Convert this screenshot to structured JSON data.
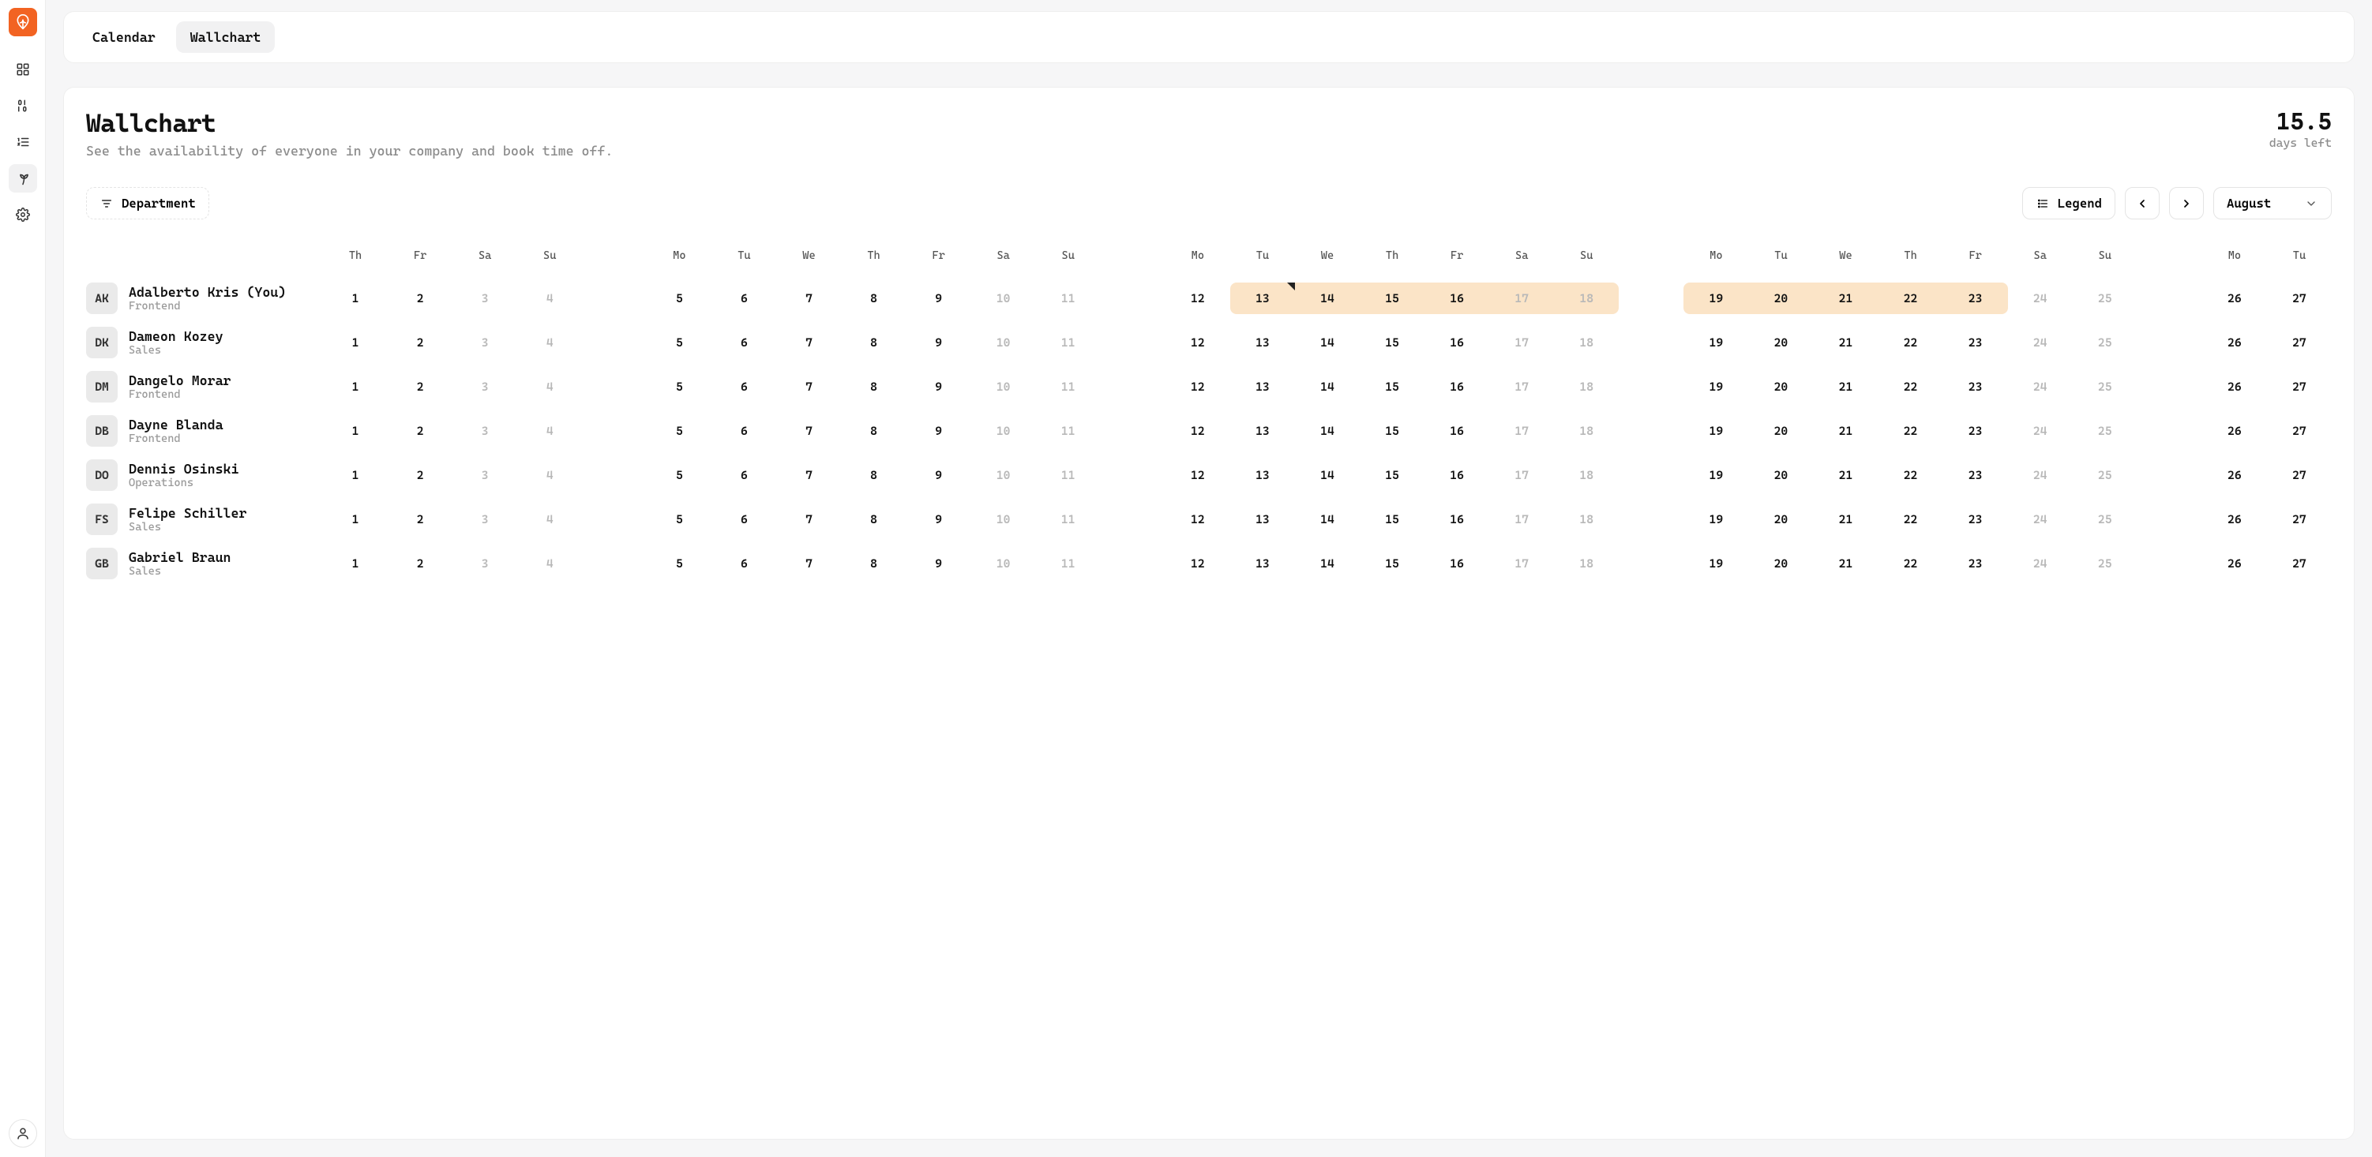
{
  "sidebar": {
    "items": [
      "dashboard",
      "binary",
      "tasks",
      "timeoff",
      "settings"
    ]
  },
  "tabs": [
    {
      "id": "calendar",
      "label": "Calendar",
      "active": false
    },
    {
      "id": "wallchart",
      "label": "Wallchart",
      "active": true
    }
  ],
  "header": {
    "title": "Wallchart",
    "subtitle": "See the availability of everyone in your company and book time off.",
    "days_left_value": "15.5",
    "days_left_label": "days left"
  },
  "controls": {
    "filter_label": "Department",
    "legend_label": "Legend",
    "month_label": "August"
  },
  "calendar": {
    "columns": [
      {
        "type": "day",
        "dow": "Th",
        "num": 1,
        "weekend": false
      },
      {
        "type": "day",
        "dow": "Fr",
        "num": 2,
        "weekend": false
      },
      {
        "type": "day",
        "dow": "Sa",
        "num": 3,
        "weekend": true
      },
      {
        "type": "day",
        "dow": "Su",
        "num": 4,
        "weekend": true
      },
      {
        "type": "spacer"
      },
      {
        "type": "day",
        "dow": "Mo",
        "num": 5,
        "weekend": false
      },
      {
        "type": "day",
        "dow": "Tu",
        "num": 6,
        "weekend": false
      },
      {
        "type": "day",
        "dow": "We",
        "num": 7,
        "weekend": false
      },
      {
        "type": "day",
        "dow": "Th",
        "num": 8,
        "weekend": false
      },
      {
        "type": "day",
        "dow": "Fr",
        "num": 9,
        "weekend": false
      },
      {
        "type": "day",
        "dow": "Sa",
        "num": 10,
        "weekend": true
      },
      {
        "type": "day",
        "dow": "Su",
        "num": 11,
        "weekend": true
      },
      {
        "type": "spacer"
      },
      {
        "type": "day",
        "dow": "Mo",
        "num": 12,
        "weekend": false
      },
      {
        "type": "day",
        "dow": "Tu",
        "num": 13,
        "weekend": false
      },
      {
        "type": "day",
        "dow": "We",
        "num": 14,
        "weekend": false
      },
      {
        "type": "day",
        "dow": "Th",
        "num": 15,
        "weekend": false
      },
      {
        "type": "day",
        "dow": "Fr",
        "num": 16,
        "weekend": false
      },
      {
        "type": "day",
        "dow": "Sa",
        "num": 17,
        "weekend": true
      },
      {
        "type": "day",
        "dow": "Su",
        "num": 18,
        "weekend": true
      },
      {
        "type": "spacer"
      },
      {
        "type": "day",
        "dow": "Mo",
        "num": 19,
        "weekend": false
      },
      {
        "type": "day",
        "dow": "Tu",
        "num": 20,
        "weekend": false
      },
      {
        "type": "day",
        "dow": "We",
        "num": 21,
        "weekend": false
      },
      {
        "type": "day",
        "dow": "Th",
        "num": 22,
        "weekend": false
      },
      {
        "type": "day",
        "dow": "Fr",
        "num": 23,
        "weekend": false
      },
      {
        "type": "day",
        "dow": "Sa",
        "num": 24,
        "weekend": true
      },
      {
        "type": "day",
        "dow": "Su",
        "num": 25,
        "weekend": true
      },
      {
        "type": "spacer"
      },
      {
        "type": "day",
        "dow": "Mo",
        "num": 26,
        "weekend": false
      },
      {
        "type": "day",
        "dow": "Tu",
        "num": 27,
        "weekend": false
      }
    ]
  },
  "people": [
    {
      "initials": "AK",
      "name": "Adalberto Kris (You)",
      "dept": "Frontend",
      "bookings": [
        {
          "from": 13,
          "to": 18,
          "note_on": 13
        },
        {
          "from": 19,
          "to": 23
        }
      ]
    },
    {
      "initials": "DK",
      "name": "Dameon Kozey",
      "dept": "Sales",
      "bookings": []
    },
    {
      "initials": "DM",
      "name": "Dangelo Morar",
      "dept": "Frontend",
      "bookings": []
    },
    {
      "initials": "DB",
      "name": "Dayne Blanda",
      "dept": "Frontend",
      "bookings": []
    },
    {
      "initials": "DO",
      "name": "Dennis Osinski",
      "dept": "Operations",
      "bookings": []
    },
    {
      "initials": "FS",
      "name": "Felipe Schiller",
      "dept": "Sales",
      "bookings": []
    },
    {
      "initials": "GB",
      "name": "Gabriel Braun",
      "dept": "Sales",
      "bookings": []
    }
  ]
}
